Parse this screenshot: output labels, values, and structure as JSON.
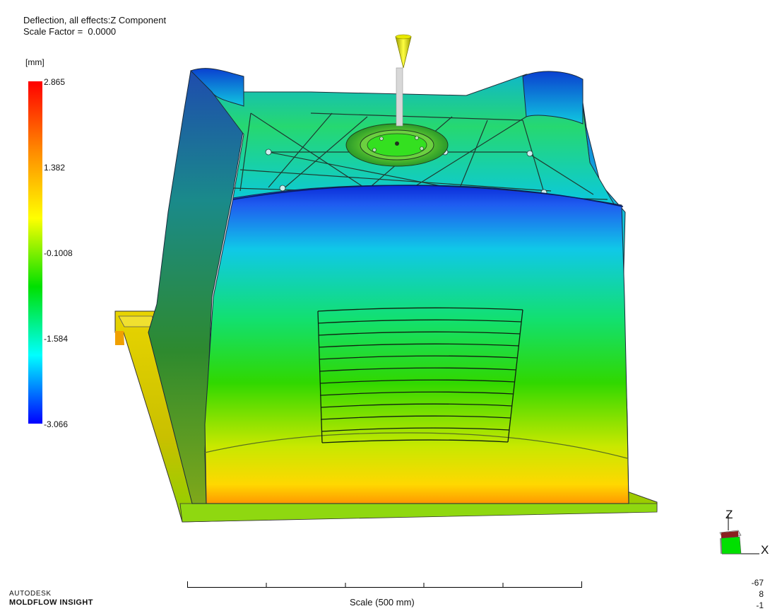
{
  "result": {
    "title": "Deflection, all effects:Z Component",
    "scale_factor": "Scale Factor =  0.0000"
  },
  "legend": {
    "unit": "[mm]",
    "max": "2.865",
    "tick_2": "1.382",
    "tick_3": "-0.1008",
    "tick_4": "-1.584",
    "min": "-3.066",
    "gradient_colors": [
      "#ff0000",
      "#ff8800",
      "#ffff00",
      "#00e000",
      "#00ffff",
      "#0000ff"
    ]
  },
  "triad": {
    "z_label": "Z",
    "x_label": "X"
  },
  "scale_bar": {
    "label": "Scale (500 mm)"
  },
  "branding": {
    "company": "AUTODESK",
    "product": "MOLDFLOW",
    "product_suffix": " INSIGHT"
  },
  "view_angles": {
    "line1": "-67",
    "line2": "8",
    "line3": "-1"
  }
}
